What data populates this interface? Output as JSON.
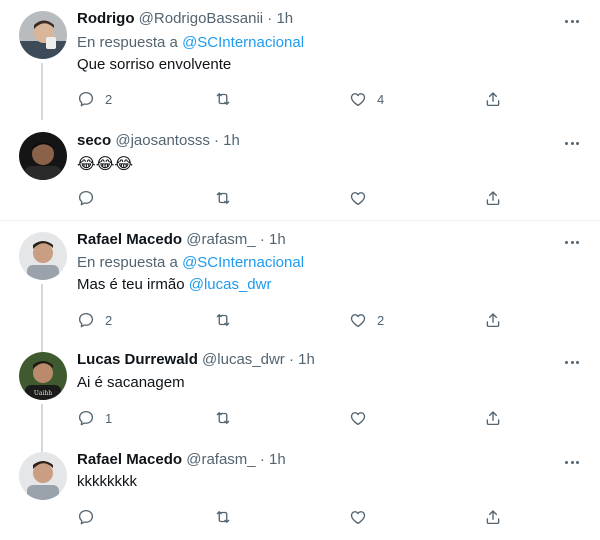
{
  "tweets": [
    {
      "name": "Rodrigo",
      "handle": "@RodrigoBassanii",
      "dot": "·",
      "time": "1h",
      "reply_prefix": "En respuesta a",
      "reply_to": "@SCInternacional",
      "text": "Que sorriso envolvente",
      "replies": "2",
      "likes": "4"
    },
    {
      "name": "seco",
      "handle": "@jaosantosss",
      "dot": "·",
      "time": "1h",
      "text": "😂😂😂"
    },
    {
      "name": "Rafael Macedo",
      "handle": "@rafasm_",
      "dot": "·",
      "time": "1h",
      "reply_prefix": "En respuesta a",
      "reply_to": "@SCInternacional",
      "text": "Mas é teu irmão",
      "mention": "@lucas_dwr",
      "replies": "2",
      "likes": "2"
    },
    {
      "name": "Lucas Durrewald",
      "handle": "@lucas_dwr",
      "dot": "·",
      "time": "1h",
      "text": "Ai é sacanagem",
      "replies": "1"
    },
    {
      "name": "Rafael Macedo",
      "handle": "@rafasm_",
      "dot": "·",
      "time": "1h",
      "text": "kkkkkkkk"
    }
  ],
  "icons": {
    "reply": "reply-icon",
    "retweet": "retweet-icon",
    "like": "heart-icon",
    "share": "share-icon",
    "more": "more-icon"
  },
  "colors": {
    "link": "#1d9bf0",
    "secondary_text": "#536471",
    "thread_line": "#cfd9de",
    "divider": "#eff3f4"
  }
}
